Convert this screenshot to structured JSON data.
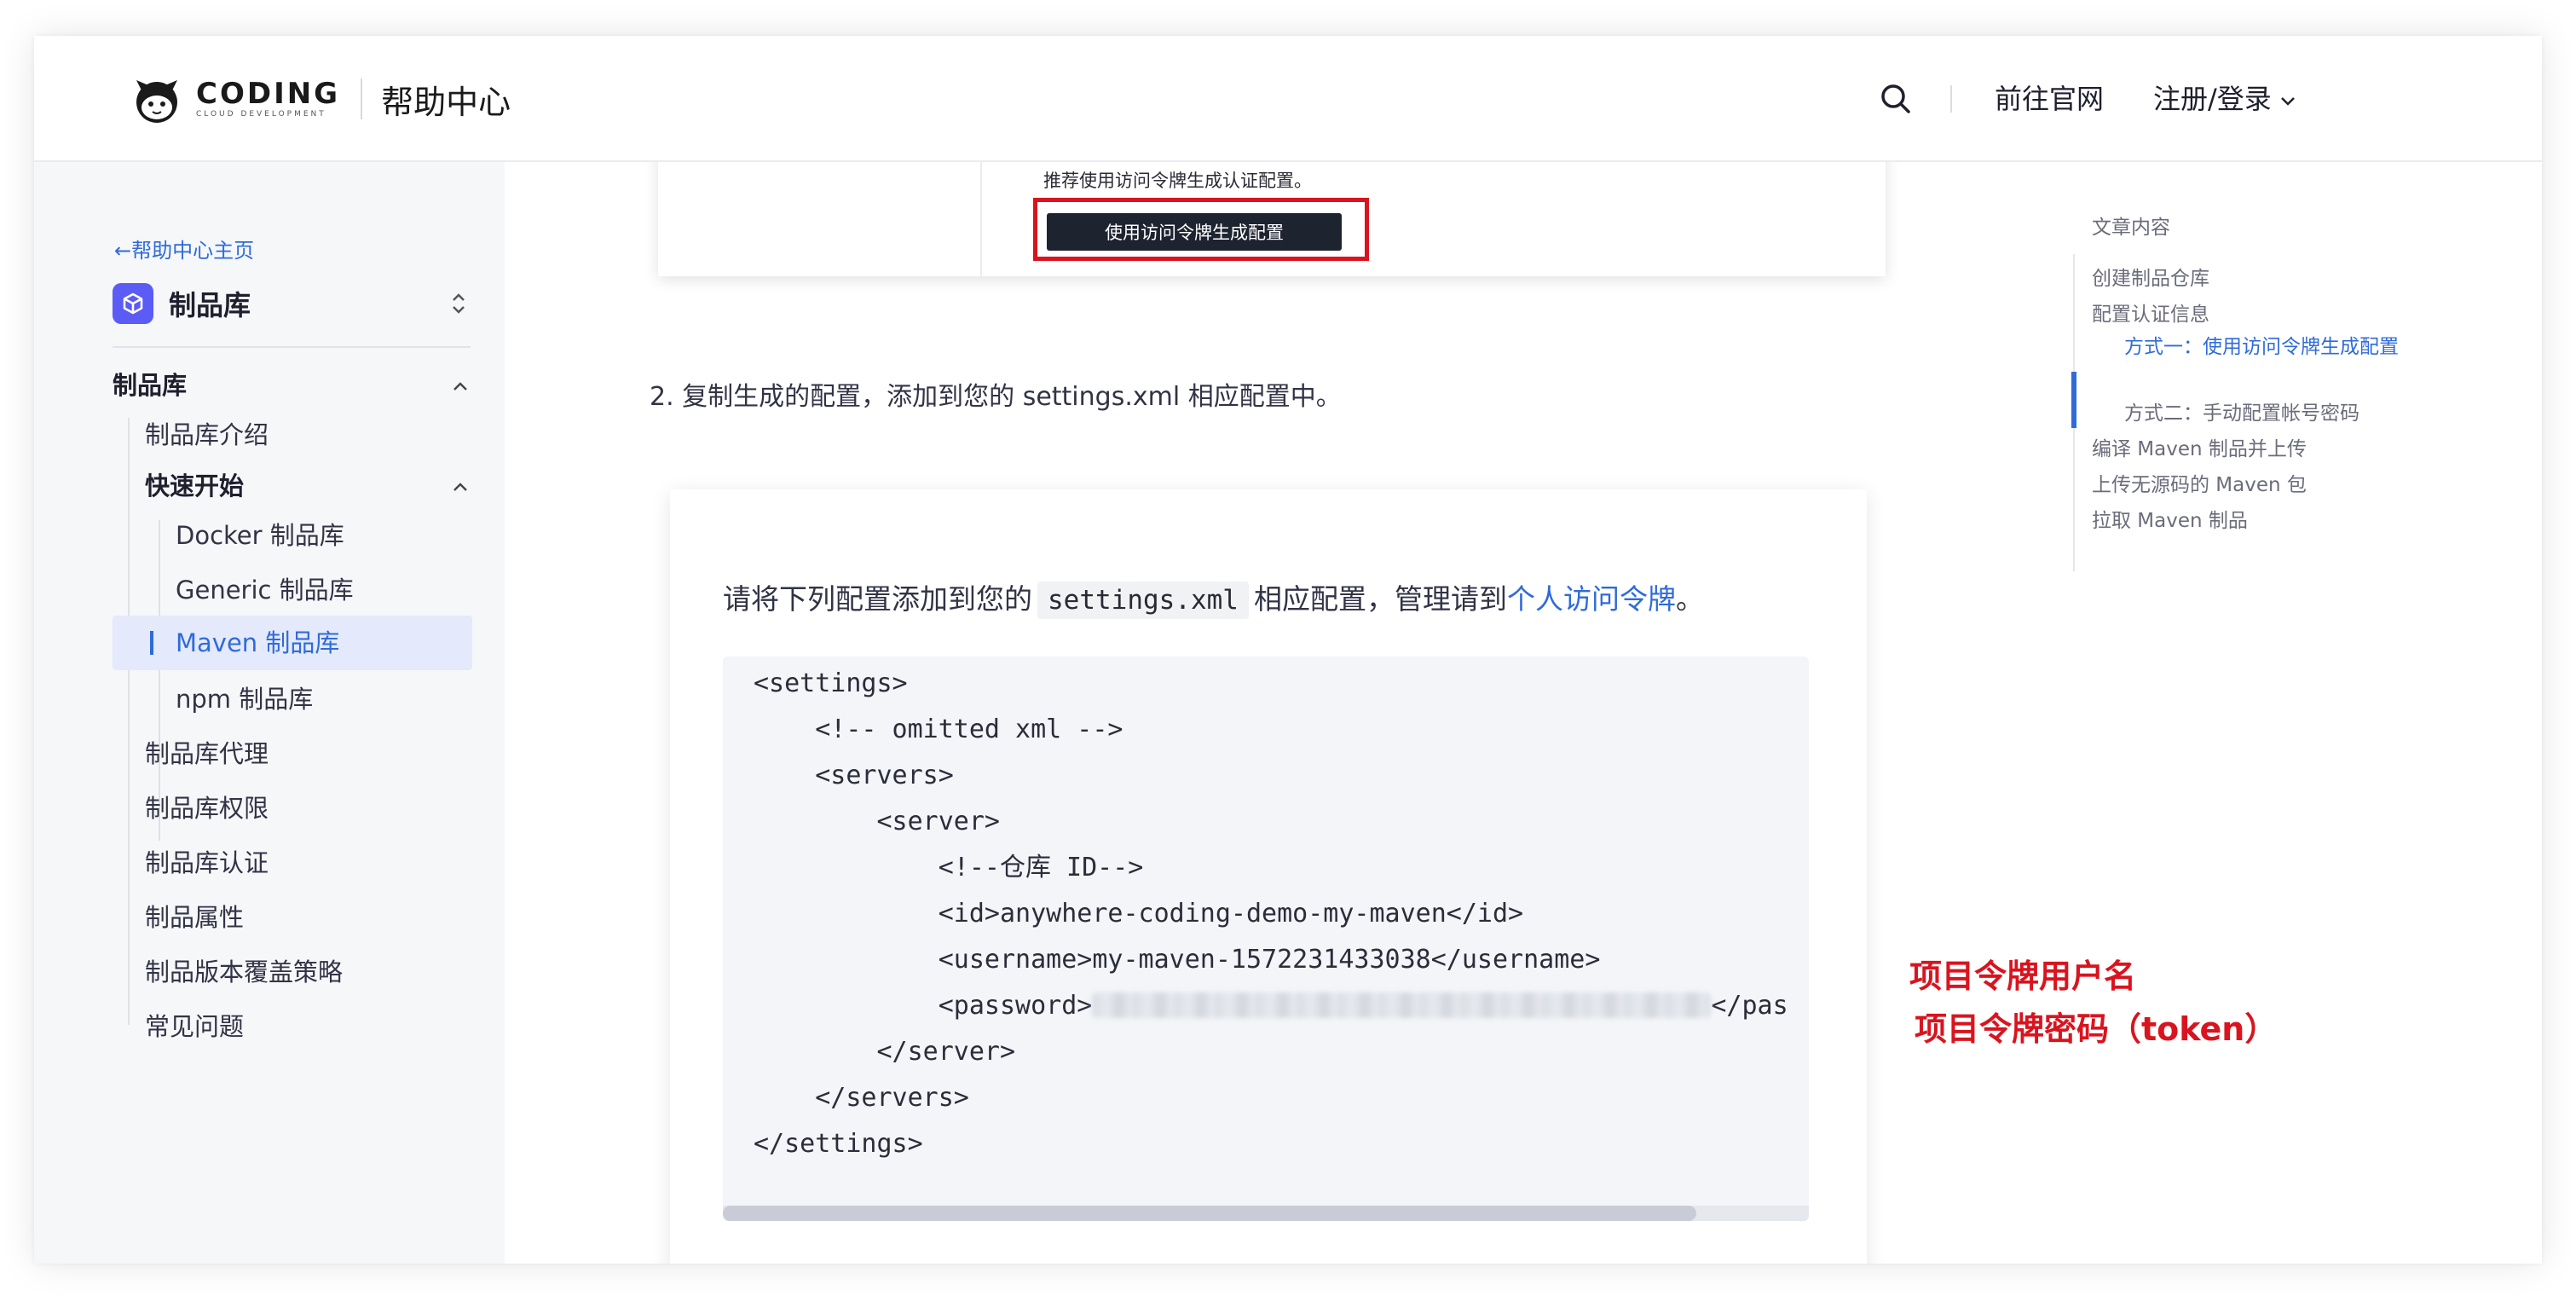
{
  "header": {
    "logo_text": "CODING",
    "logo_sub": "CLOUD DEVELOPMENT",
    "help_title": "帮助中心",
    "nav_official": "前往官网",
    "nav_login": "注册/登录"
  },
  "sidebar": {
    "back_label": "←帮助中心主页",
    "product_name": "制品库",
    "items": [
      {
        "label": "制品库"
      },
      {
        "label": "制品库介绍"
      },
      {
        "label": "快速开始"
      },
      {
        "label": "Docker 制品库"
      },
      {
        "label": "Generic 制品库"
      },
      {
        "label": "Maven 制品库"
      },
      {
        "label": "npm 制品库"
      },
      {
        "label": "制品库代理"
      },
      {
        "label": "制品库权限"
      },
      {
        "label": "制品库认证"
      },
      {
        "label": "制品属性"
      },
      {
        "label": "制品版本覆盖策略"
      },
      {
        "label": "常见问题"
      }
    ]
  },
  "main": {
    "shot_hint": "推荐使用访问令牌生成认证配置。",
    "shot_button": "使用访问令牌生成配置",
    "step2": "2. 复制生成的配置，添加到您的 settings.xml 相应配置中。",
    "intro_pre": "请将下列配置添加到您的",
    "intro_code": "settings.xml",
    "intro_mid": "相应配置，管理请到",
    "intro_link": "个人访问令牌",
    "intro_end": "。",
    "code_lines": [
      "<settings>",
      "    <!-- omitted xml -->",
      "    <servers>",
      "        <server>",
      "            <!--仓库 ID-->",
      "            <id>anywhere-coding-demo-my-maven</id>",
      "            <username>my-maven-1572231433038</username>",
      "            <password>",
      "        </server>",
      "    </servers>",
      "</settings>"
    ],
    "password_tail": "</pas",
    "annotations": {
      "username": "项目令牌用户名",
      "token": "项目令牌密码（token）"
    }
  },
  "toc": {
    "title": "文章内容",
    "items": [
      "创建制品仓库",
      "配置认证信息",
      "方式一：使用访问令牌生成配置",
      "方式二：手动配置帐号密码",
      "编译 Maven 制品并上传",
      "上传无源码的 Maven 包",
      "拉取 Maven 制品"
    ]
  },
  "colors": {
    "accent": "#2f6bd9",
    "annotation_red": "#d9141f",
    "product_icon": "#5b5bf5"
  }
}
